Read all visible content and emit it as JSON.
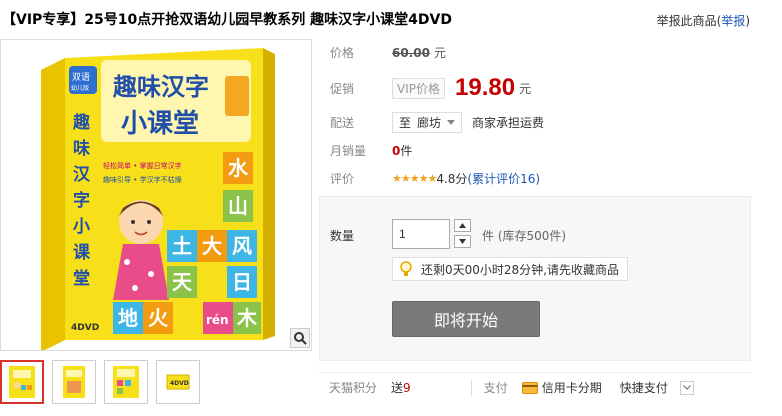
{
  "title": {
    "tag": "【VIP专享】",
    "text": "25号10点开抢双语幼儿园早教系列 趣味汉字小课堂4DVD"
  },
  "report": {
    "text": "举报此商品(",
    "link": "举报",
    "close": ")"
  },
  "gallery": {
    "box_title": "趣味汉字",
    "box_title2": "小课堂",
    "spine": "趣味汉字小课堂",
    "badge": "双语",
    "badge_sub": "幼儿版",
    "tagline1": "轻松简单 • 掌握日常汉字",
    "tagline2": "趣味引导 • 学汉字不枯燥",
    "dvd_label": "4DVD",
    "tiles": [
      "水",
      "山",
      "土",
      "大",
      "风",
      "天",
      "日",
      "地",
      "火",
      "木"
    ],
    "pinyin": "rén",
    "thumb_dvd": "4DVD"
  },
  "price": {
    "label": "价格",
    "original": "60.00",
    "unit": "元"
  },
  "promo": {
    "label": "促销",
    "vip_tag": "VIP价格",
    "price": "19.80",
    "unit": "元"
  },
  "delivery": {
    "label": "配送",
    "to": "至",
    "city": "廊坊",
    "fee": "商家承担运费"
  },
  "sales": {
    "label": "月销量",
    "count": "0",
    "unit": "件"
  },
  "rating": {
    "label": "评价",
    "stars": "★★★★★",
    "score": "4.8分",
    "reviews": "(累计评价16)"
  },
  "purchase": {
    "qty_label": "数量",
    "qty_value": "1",
    "stock": "件 (库存500件)",
    "countdown": "还剩0天00小时28分钟,请先收藏商品",
    "start_button": "即将开始"
  },
  "footer": {
    "tmall_points": "天猫积分",
    "send": "送",
    "points": "9",
    "pay": "支付",
    "installment": "信用卡分期",
    "quick_pay": "快捷支付"
  },
  "colors": {
    "price_red": "#c40000",
    "link_blue": "#1a57b5",
    "box_yellow": "#f7e01a",
    "button_gray": "#7a7a7a"
  }
}
